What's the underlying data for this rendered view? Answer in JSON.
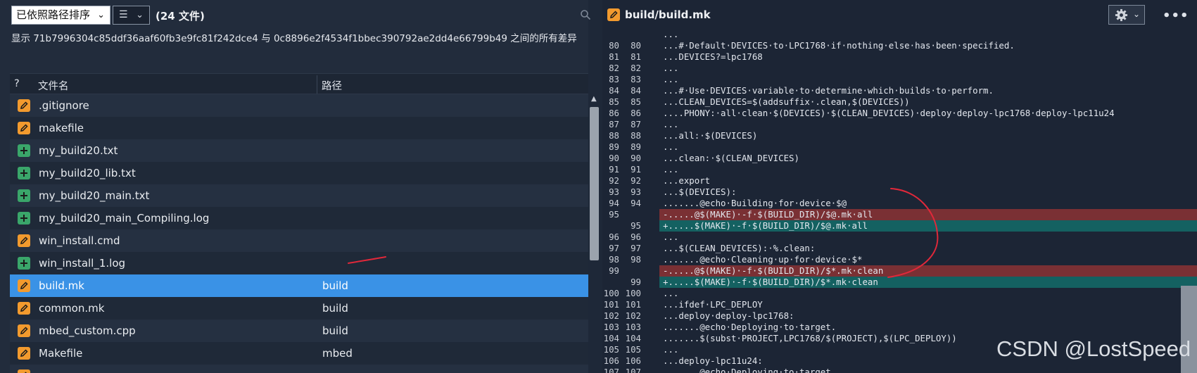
{
  "toolbar": {
    "sort_label": "已依照路径排序",
    "view_icon": "list-view-icon",
    "file_count": "(24 文件)"
  },
  "diff_info": "显示 71b7996304c85ddf36aaf60fb3e9fc81f242dce4 与 0c8896e2f4534f1bbec390792ae2dd4e66799b49 之间的所有差异",
  "grid": {
    "col_status": "?",
    "col_name": "文件名",
    "col_path": "路径"
  },
  "files": [
    {
      "name": ".gitignore",
      "path": "",
      "status": "modified"
    },
    {
      "name": "makefile",
      "path": "",
      "status": "modified"
    },
    {
      "name": "my_build20.txt",
      "path": "",
      "status": "added"
    },
    {
      "name": "my_build20_lib.txt",
      "path": "",
      "status": "added"
    },
    {
      "name": "my_build20_main.txt",
      "path": "",
      "status": "added"
    },
    {
      "name": "my_build20_main_Compiling.log",
      "path": "",
      "status": "added"
    },
    {
      "name": "win_install.cmd",
      "path": "",
      "status": "modified"
    },
    {
      "name": "win_install_1.log",
      "path": "",
      "status": "added"
    },
    {
      "name": "build.mk",
      "path": "build",
      "status": "modified",
      "selected": true
    },
    {
      "name": "common.mk",
      "path": "build",
      "status": "modified"
    },
    {
      "name": "mbed_custom.cpp",
      "path": "build",
      "status": "modified"
    },
    {
      "name": "Makefile",
      "path": "mbed",
      "status": "modified"
    },
    {
      "name": "",
      "path": "",
      "status": "modified"
    }
  ],
  "right_header": {
    "file_title": "build/build.mk",
    "gear_icon": "gear-icon",
    "more_icon": "more-icon"
  },
  "diff_lines": [
    {
      "o": "",
      "n": "",
      "type": "ctx",
      "text": "..."
    },
    {
      "o": "80",
      "n": "80",
      "type": "ctx",
      "text": "...#·Default·DEVICES·to·LPC1768·if·nothing·else·has·been·specified."
    },
    {
      "o": "81",
      "n": "81",
      "type": "ctx",
      "text": "...DEVICES?=lpc1768"
    },
    {
      "o": "82",
      "n": "82",
      "type": "ctx",
      "text": "..."
    },
    {
      "o": "83",
      "n": "83",
      "type": "ctx",
      "text": "..."
    },
    {
      "o": "84",
      "n": "84",
      "type": "ctx",
      "text": "...#·Use·DEVICES·variable·to·determine·which·builds·to·perform."
    },
    {
      "o": "85",
      "n": "85",
      "type": "ctx",
      "text": "...CLEAN_DEVICES=$(addsuffix·.clean,$(DEVICES))"
    },
    {
      "o": "86",
      "n": "86",
      "type": "ctx",
      "text": "....PHONY:·all·clean·$(DEVICES)·$(CLEAN_DEVICES)·deploy·deploy-lpc1768·deploy-lpc11u24"
    },
    {
      "o": "87",
      "n": "87",
      "type": "ctx",
      "text": "..."
    },
    {
      "o": "88",
      "n": "88",
      "type": "ctx",
      "text": "...all:·$(DEVICES)"
    },
    {
      "o": "89",
      "n": "89",
      "type": "ctx",
      "text": "..."
    },
    {
      "o": "90",
      "n": "90",
      "type": "ctx",
      "text": "...clean:·$(CLEAN_DEVICES)"
    },
    {
      "o": "91",
      "n": "91",
      "type": "ctx",
      "text": "..."
    },
    {
      "o": "92",
      "n": "92",
      "type": "ctx",
      "text": "...export"
    },
    {
      "o": "93",
      "n": "93",
      "type": "ctx",
      "text": "...$(DEVICES):"
    },
    {
      "o": "94",
      "n": "94",
      "type": "ctx",
      "text": ".......@echo·Building·for·device·$@"
    },
    {
      "o": "95",
      "n": "",
      "type": "del",
      "text": "-.....@$(MAKE)·-f·$(BUILD_DIR)/$@.mk·all"
    },
    {
      "o": "",
      "n": "95",
      "type": "add",
      "text": "+.....$(MAKE)·-f·$(BUILD_DIR)/$@.mk·all"
    },
    {
      "o": "96",
      "n": "96",
      "type": "ctx",
      "text": "..."
    },
    {
      "o": "97",
      "n": "97",
      "type": "ctx",
      "text": "...$(CLEAN_DEVICES):·%.clean:"
    },
    {
      "o": "98",
      "n": "98",
      "type": "ctx",
      "text": ".......@echo·Cleaning·up·for·device·$*"
    },
    {
      "o": "99",
      "n": "",
      "type": "del",
      "text": "-.....@$(MAKE)·-f·$(BUILD_DIR)/$*.mk·clean"
    },
    {
      "o": "",
      "n": "99",
      "type": "add",
      "text": "+.....$(MAKE)·-f·$(BUILD_DIR)/$*.mk·clean"
    },
    {
      "o": "100",
      "n": "100",
      "type": "ctx",
      "text": "..."
    },
    {
      "o": "101",
      "n": "101",
      "type": "ctx",
      "text": "...ifdef·LPC_DEPLOY"
    },
    {
      "o": "102",
      "n": "102",
      "type": "ctx",
      "text": "...deploy·deploy-lpc1768:"
    },
    {
      "o": "103",
      "n": "103",
      "type": "ctx",
      "text": ".......@echo·Deploying·to·target."
    },
    {
      "o": "104",
      "n": "104",
      "type": "ctx",
      "text": ".......$(subst·PROJECT,LPC1768/$(PROJECT),$(LPC_DEPLOY))"
    },
    {
      "o": "105",
      "n": "105",
      "type": "ctx",
      "text": "..."
    },
    {
      "o": "106",
      "n": "106",
      "type": "ctx",
      "text": "...deploy-lpc11u24:"
    },
    {
      "o": "107",
      "n": "107",
      "type": "ctx",
      "text": ".......@echo·Deploying·to·target."
    }
  ],
  "watermark": "CSDN @LostSpeed",
  "colors": {
    "modified": "#f29a2e",
    "added": "#3aa66a",
    "selected": "#3a92e6",
    "deleted_line": "#7a3034",
    "added_line": "#146161",
    "annotation": "#e0283a"
  }
}
